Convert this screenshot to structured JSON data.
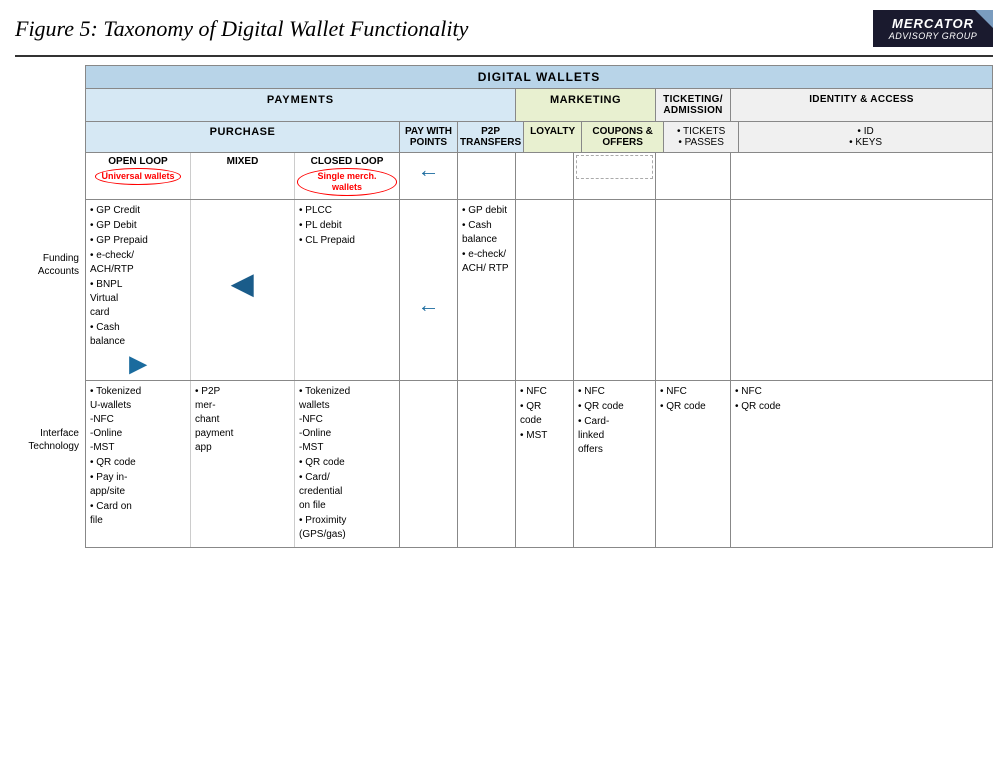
{
  "title": "Figure 5: Taxonomy of Digital Wallet Functionality",
  "logo": {
    "line1": "MERCATOR",
    "line2": "ADVISORY GROUP"
  },
  "table": {
    "dw_header": "DIGITAL WALLETS",
    "col_payments": "PAYMENTS",
    "col_marketing": "MARKETING",
    "col_ticketing": "TICKETING/ ADMISSION",
    "col_identity": "IDENTITY & ACCESS",
    "sub_purchase": "PURCHASE",
    "sub_pay_with_points": "PAY WITH POINTS",
    "sub_p2p": "P2P TRANSFERS",
    "sub_loyalty": "LOYALTY",
    "sub_coupons": "COUPONS & OFFERS",
    "sub_tickets": "• TICKETS\n• PASSES",
    "sub_id": "• ID\n• KEYS",
    "loop_open": "OPEN LOOP",
    "loop_mixed": "MIXED",
    "loop_closed": "CLOSED LOOP",
    "oval_open": "Universal wallets",
    "oval_closed": "Single merch. wallets",
    "row_labels": {
      "funding": "Funding Accounts",
      "interface": "Interface Technology"
    },
    "funding": {
      "open_loop": "GP Credit\nGP Debit\nGP Prepaid\ne-check/\nACH/RTP\nBNPL\nVirtual\ncard\nCash\nbalance",
      "mixed": "",
      "closed_loop": "PLCC\nPL debit\nCL Prepaid",
      "p2p": "GP debit\nCash\nbalance\ne-check/\nACH/ RTP",
      "loyalty": "",
      "coupons": "",
      "tickets": "",
      "id": ""
    },
    "interface": {
      "open_loop": "Tokenized\nU-wallets\n-NFC\n-Online\n-MST\nQR code\nPay in-\napp/site\nCard on\nfile",
      "mixed": "P2P\nmer-\nchant\npayment\napp",
      "closed_loop": "Tokenized\nwallets\n-NFC\n-Online\n-MST\nQR code\nCard/\ncredential\non file\nProximity\n(GPS/gas)",
      "loyalty": "NFC\nQR\ncode\nMST",
      "coupons": "NFC\nQR code\nCard-\nlinked\noffers",
      "tickets": "NFC\nQR code",
      "id": "NFC\nQR code"
    }
  }
}
